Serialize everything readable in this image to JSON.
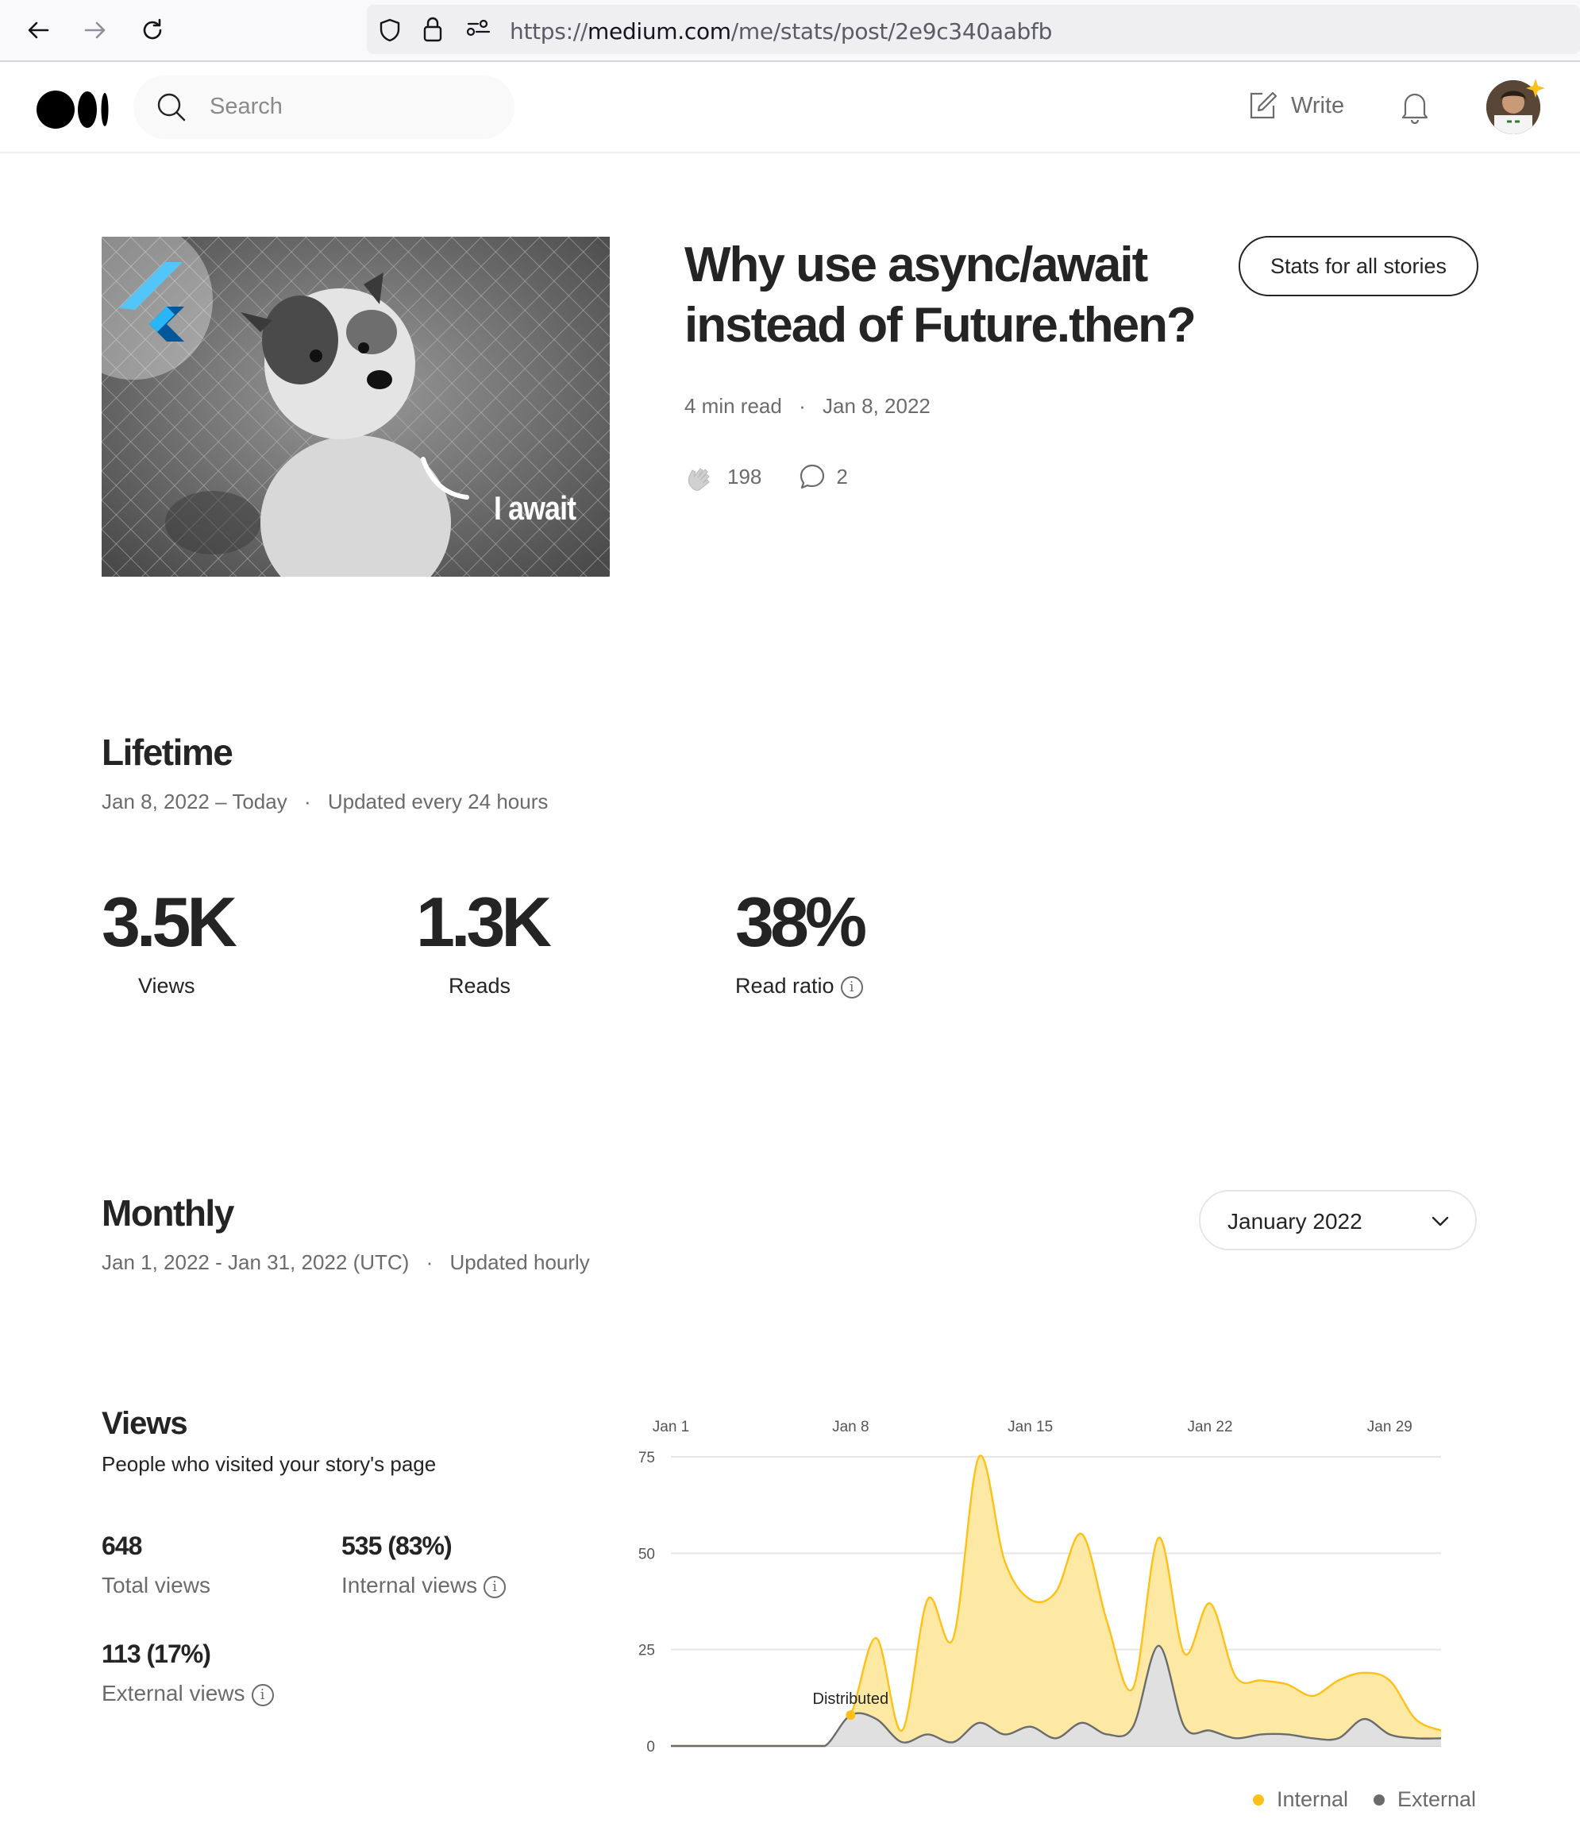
{
  "browser": {
    "url_scheme": "https://",
    "url_host": "medium.com",
    "url_path": "/me/stats/post/2e9c340aabfb"
  },
  "header": {
    "search_placeholder": "Search",
    "write_label": "Write"
  },
  "story": {
    "image_caption": "I await",
    "title": "Why use async/await instead of Future.then?",
    "read_time": "4 min read",
    "date": "Jan 8, 2022",
    "claps": "198",
    "responses": "2",
    "stats_all_label": "Stats for all stories"
  },
  "lifetime": {
    "heading": "Lifetime",
    "range": "Jan 8, 2022 – Today",
    "update_note": "Updated every 24 hours",
    "stats": [
      {
        "value": "3.5K",
        "label": "Views"
      },
      {
        "value": "1.3K",
        "label": "Reads"
      },
      {
        "value": "38%",
        "label": "Read ratio"
      }
    ]
  },
  "monthly": {
    "heading": "Monthly",
    "range": "Jan 1, 2022 - Jan 31, 2022 (UTC)",
    "update_note": "Updated hourly",
    "selected_month": "January 2022"
  },
  "views": {
    "heading": "Views",
    "description": "People who visited your story's page",
    "total_value": "648",
    "total_label": "Total views",
    "internal_value": "535 (83%)",
    "internal_label": "Internal views",
    "external_value": "113 (17%)",
    "external_label": "External views"
  },
  "chart_data": {
    "type": "area",
    "x_ticks": [
      "Jan 1",
      "Jan 8",
      "Jan 15",
      "Jan 22",
      "Jan 29"
    ],
    "y_ticks": [
      0,
      25,
      50,
      75
    ],
    "ylim": [
      0,
      75
    ],
    "x": [
      1,
      2,
      3,
      4,
      5,
      6,
      7,
      8,
      9,
      10,
      11,
      12,
      13,
      14,
      15,
      16,
      17,
      18,
      19,
      20,
      21,
      22,
      23,
      24,
      25,
      26,
      27,
      28,
      29,
      30,
      31
    ],
    "annotation": {
      "label": "Distributed",
      "x": 8,
      "y": 8
    },
    "legend_position": "bottom-right",
    "series": [
      {
        "name": "Internal",
        "color": "#ffc017",
        "values": [
          0,
          0,
          0,
          0,
          0,
          0,
          0,
          8,
          28,
          4,
          38,
          28,
          75,
          48,
          38,
          40,
          55,
          32,
          15,
          54,
          24,
          37,
          18,
          17,
          16,
          13,
          17,
          19,
          17,
          7,
          4
        ]
      },
      {
        "name": "External",
        "color": "#6b6b6b",
        "values": [
          0,
          0,
          0,
          0,
          0,
          0,
          0,
          8,
          7,
          1,
          3,
          1,
          6,
          3,
          5,
          2,
          6,
          3,
          5,
          26,
          5,
          4,
          2,
          3,
          3,
          2,
          2,
          7,
          3,
          2,
          2
        ]
      }
    ]
  }
}
